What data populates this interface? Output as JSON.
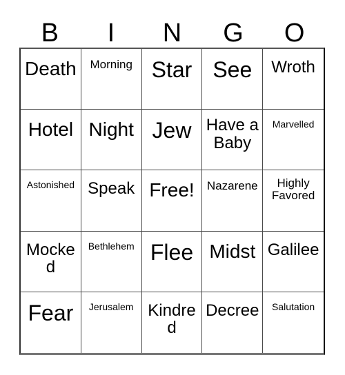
{
  "card": {
    "title_letters": [
      "B",
      "I",
      "N",
      "G",
      "O"
    ],
    "columns": 5,
    "rows": 5,
    "free_space_label": "Free!",
    "grid": [
      [
        {
          "label": "Death",
          "size": "lg",
          "lines": 1
        },
        {
          "label": "Morning",
          "size": "sm",
          "lines": 1
        },
        {
          "label": "Star",
          "size": "xl",
          "lines": 1
        },
        {
          "label": "See",
          "size": "xl",
          "lines": 1
        },
        {
          "label": "Wroth",
          "size": "md",
          "lines": 1
        }
      ],
      [
        {
          "label": "Hotel",
          "size": "lg",
          "lines": 1
        },
        {
          "label": "Night",
          "size": "lg",
          "lines": 1
        },
        {
          "label": "Jew",
          "size": "xl",
          "lines": 1
        },
        {
          "label": "Have a Baby",
          "size": "md",
          "lines": 2
        },
        {
          "label": "Marvelled",
          "size": "xs",
          "lines": 1
        }
      ],
      [
        {
          "label": "Astonished",
          "size": "xs",
          "lines": 1
        },
        {
          "label": "Speak",
          "size": "md",
          "lines": 1
        },
        {
          "label": "Free!",
          "size": "lg",
          "lines": 1
        },
        {
          "label": "Nazarene",
          "size": "sm",
          "lines": 1
        },
        {
          "label": "Highly Favored",
          "size": "sm",
          "lines": 2
        }
      ],
      [
        {
          "label": "Mocked",
          "size": "md",
          "lines": 1
        },
        {
          "label": "Bethlehem",
          "size": "xs",
          "lines": 1
        },
        {
          "label": "Flee",
          "size": "xl",
          "lines": 1
        },
        {
          "label": "Midst",
          "size": "lg",
          "lines": 1
        },
        {
          "label": "Galilee",
          "size": "md",
          "lines": 1
        }
      ],
      [
        {
          "label": "Fear",
          "size": "xl",
          "lines": 1
        },
        {
          "label": "Jerusalem",
          "size": "xs",
          "lines": 1
        },
        {
          "label": "Kindred",
          "size": "md",
          "lines": 1
        },
        {
          "label": "Decree",
          "size": "md",
          "lines": 1
        },
        {
          "label": "Salutation",
          "size": "xs",
          "lines": 1
        }
      ]
    ]
  },
  "colors": {
    "background": "#ffffff",
    "text": "#000000",
    "grid_line": "#4a4a4a",
    "border": "#333333"
  }
}
